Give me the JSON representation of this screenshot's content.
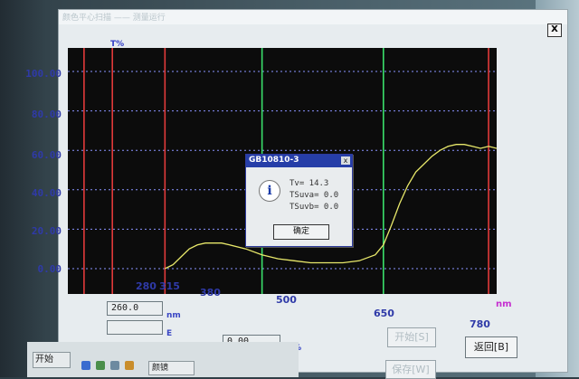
{
  "window": {
    "title": "颜色平心扫描 —— 测量运行",
    "close_label": "X"
  },
  "axis": {
    "y_unit": "T%",
    "x_unit": "nm",
    "y_ticks": [
      "100.00",
      "80.00",
      "60.00",
      "40.00",
      "20.00",
      "0.00"
    ],
    "x_ticks": [
      "280",
      "315",
      "380",
      "500",
      "650",
      "780"
    ]
  },
  "chart_data": {
    "type": "line",
    "ylabel": "T%",
    "xlabel": "nm",
    "xlim": [
      260,
      790
    ],
    "ylim": [
      0,
      100
    ],
    "grid": true,
    "x_ticks": [
      280,
      315,
      380,
      500,
      650,
      780
    ],
    "y_ticks": [
      0,
      20,
      40,
      60,
      80,
      100
    ],
    "markers": [
      {
        "x": 280,
        "color": "#e23a3a"
      },
      {
        "x": 315,
        "color": "#e23a3a"
      },
      {
        "x": 380,
        "color": "#e23a3a"
      },
      {
        "x": 500,
        "color": "#3adf6a"
      },
      {
        "x": 650,
        "color": "#3adf6a"
      },
      {
        "x": 780,
        "color": "#e23a3a"
      }
    ],
    "series": [
      {
        "color": "#e8e86a",
        "x": [
          380,
          390,
          400,
          410,
          420,
          430,
          440,
          450,
          460,
          480,
          500,
          520,
          540,
          560,
          580,
          600,
          620,
          640,
          650,
          660,
          670,
          680,
          690,
          700,
          710,
          720,
          730,
          740,
          750,
          760,
          770,
          780,
          790
        ],
        "y": [
          0,
          2,
          6,
          10,
          12,
          13,
          13,
          13,
          12,
          10,
          7,
          5,
          4,
          3,
          3,
          3,
          4,
          7,
          12,
          22,
          33,
          42,
          49,
          53,
          57,
          60,
          62,
          63,
          63,
          62,
          61,
          62,
          61
        ]
      }
    ]
  },
  "fields": {
    "wavelength_value": "260.0",
    "wavelength_unit": "nm",
    "e_label": "E",
    "t_value": "0.00",
    "t_unit": "T%"
  },
  "buttons": {
    "start_label": "开始[S]",
    "return_label": "返回[B]",
    "save_label": "保存[W]"
  },
  "dialog": {
    "title": "GB10810-3",
    "close_label": "x",
    "lines": [
      "Tv= 14.3",
      "TSuva= 0.0",
      "TSuvb= 0.0"
    ],
    "ok_label": "确定"
  },
  "taskbar": {
    "start_label": "开始",
    "task_label": "颜镜"
  }
}
